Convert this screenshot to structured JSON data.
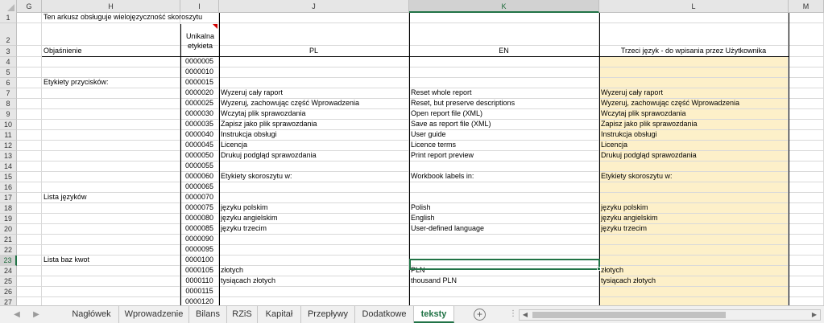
{
  "columns": [
    "G",
    "H",
    "I",
    "J",
    "K",
    "L",
    "M"
  ],
  "selected_column": "K",
  "selected_row": "23",
  "rows": [
    {
      "num": "1",
      "H": "Ten arkusz obsługuje wielojęzyczność skoroszytu",
      "I": "",
      "J": "",
      "K": "",
      "L": ""
    },
    {
      "num": "2",
      "H": "",
      "I": "Unikalna etykieta",
      "J": "",
      "K": "",
      "L": ""
    },
    {
      "num": "3",
      "H": "Objaśnienie",
      "I": "",
      "J": "PL",
      "K": "EN",
      "L": "Trzeci język - do wpisania przez Użytkownika"
    },
    {
      "num": "4",
      "H": "",
      "I": "0000005",
      "J": "",
      "K": "",
      "L": ""
    },
    {
      "num": "5",
      "H": "",
      "I": "0000010",
      "J": "",
      "K": "",
      "L": ""
    },
    {
      "num": "6",
      "H": "Etykiety przycisków:",
      "I": "0000015",
      "J": "",
      "K": "",
      "L": ""
    },
    {
      "num": "7",
      "H": "",
      "I": "0000020",
      "J": "Wyzeruj cały raport",
      "K": "Reset whole report",
      "L": "Wyzeruj cały raport"
    },
    {
      "num": "8",
      "H": "",
      "I": "0000025",
      "J": "Wyzeruj, zachowując część Wprowadzenia",
      "K": "Reset, but preserve descriptions",
      "L": "Wyzeruj, zachowując część Wprowadzenia"
    },
    {
      "num": "9",
      "H": "",
      "I": "0000030",
      "J": "Wczytaj plik sprawozdania",
      "K": "Open report file (XML)",
      "L": "Wczytaj plik sprawozdania"
    },
    {
      "num": "10",
      "H": "",
      "I": "0000035",
      "J": "Zapisz jako plik sprawozdania",
      "K": "Save as report file (XML)",
      "L": "Zapisz jako plik sprawozdania"
    },
    {
      "num": "11",
      "H": "",
      "I": "0000040",
      "J": "Instrukcja obsługi",
      "K": "User guide",
      "L": "Instrukcja obsługi"
    },
    {
      "num": "12",
      "H": "",
      "I": "0000045",
      "J": "Licencja",
      "K": "Licence terms",
      "L": "Licencja"
    },
    {
      "num": "13",
      "H": "",
      "I": "0000050",
      "J": "Drukuj podgląd sprawozdania",
      "K": "Print report preview",
      "L": "Drukuj podgląd sprawozdania"
    },
    {
      "num": "14",
      "H": "",
      "I": "0000055",
      "J": "",
      "K": "",
      "L": ""
    },
    {
      "num": "15",
      "H": "",
      "I": "0000060",
      "J": "Etykiety skoroszytu w:",
      "K": "Workbook labels in:",
      "L": "Etykiety skoroszytu w:"
    },
    {
      "num": "16",
      "H": "",
      "I": "0000065",
      "J": "",
      "K": "",
      "L": ""
    },
    {
      "num": "17",
      "H": "Lista języków",
      "I": "0000070",
      "J": "",
      "K": "",
      "L": ""
    },
    {
      "num": "18",
      "H": "",
      "I": "0000075",
      "J": "języku polskim",
      "K": "Polish",
      "L": "języku polskim"
    },
    {
      "num": "19",
      "H": "",
      "I": "0000080",
      "J": "języku angielskim",
      "K": "English",
      "L": "języku angielskim"
    },
    {
      "num": "20",
      "H": "",
      "I": "0000085",
      "J": "języku trzecim",
      "K": "User-defined language",
      "L": "języku trzecim"
    },
    {
      "num": "21",
      "H": "",
      "I": "0000090",
      "J": "",
      "K": "",
      "L": ""
    },
    {
      "num": "22",
      "H": "",
      "I": "0000095",
      "J": "",
      "K": "",
      "L": ""
    },
    {
      "num": "23",
      "H": "Lista baz kwot",
      "I": "0000100",
      "J": "",
      "K": "",
      "L": ""
    },
    {
      "num": "24",
      "H": "",
      "I": "0000105",
      "J": "złotych",
      "K": "PLN",
      "L": "złotych"
    },
    {
      "num": "25",
      "H": "",
      "I": "0000110",
      "J": "tysiącach złotych",
      "K": "thousand PLN",
      "L": "tysiącach złotych"
    },
    {
      "num": "26",
      "H": "",
      "I": "0000115",
      "J": "",
      "K": "",
      "L": ""
    },
    {
      "num": "27",
      "H": "",
      "I": "0000120",
      "J": "",
      "K": "",
      "L": ""
    }
  ],
  "tabs": [
    {
      "label": "Nagłówek",
      "active": false
    },
    {
      "label": "Wprowadzenie",
      "active": false
    },
    {
      "label": "Bilans",
      "active": false
    },
    {
      "label": "RZiS",
      "active": false
    },
    {
      "label": "Kapitał",
      "active": false
    },
    {
      "label": "Przepływy",
      "active": false
    },
    {
      "label": "Dodatkowe",
      "active": false
    },
    {
      "label": "teksty",
      "active": true
    }
  ],
  "nav": {
    "prev": "◀",
    "next": "▶",
    "add": "+",
    "dots": "⋮",
    "scroll_left": "◀",
    "scroll_right": "▶"
  },
  "colors": {
    "accent": "#217346",
    "third_language_fill": "#fdf0c9",
    "comment_marker": "#d00000"
  }
}
